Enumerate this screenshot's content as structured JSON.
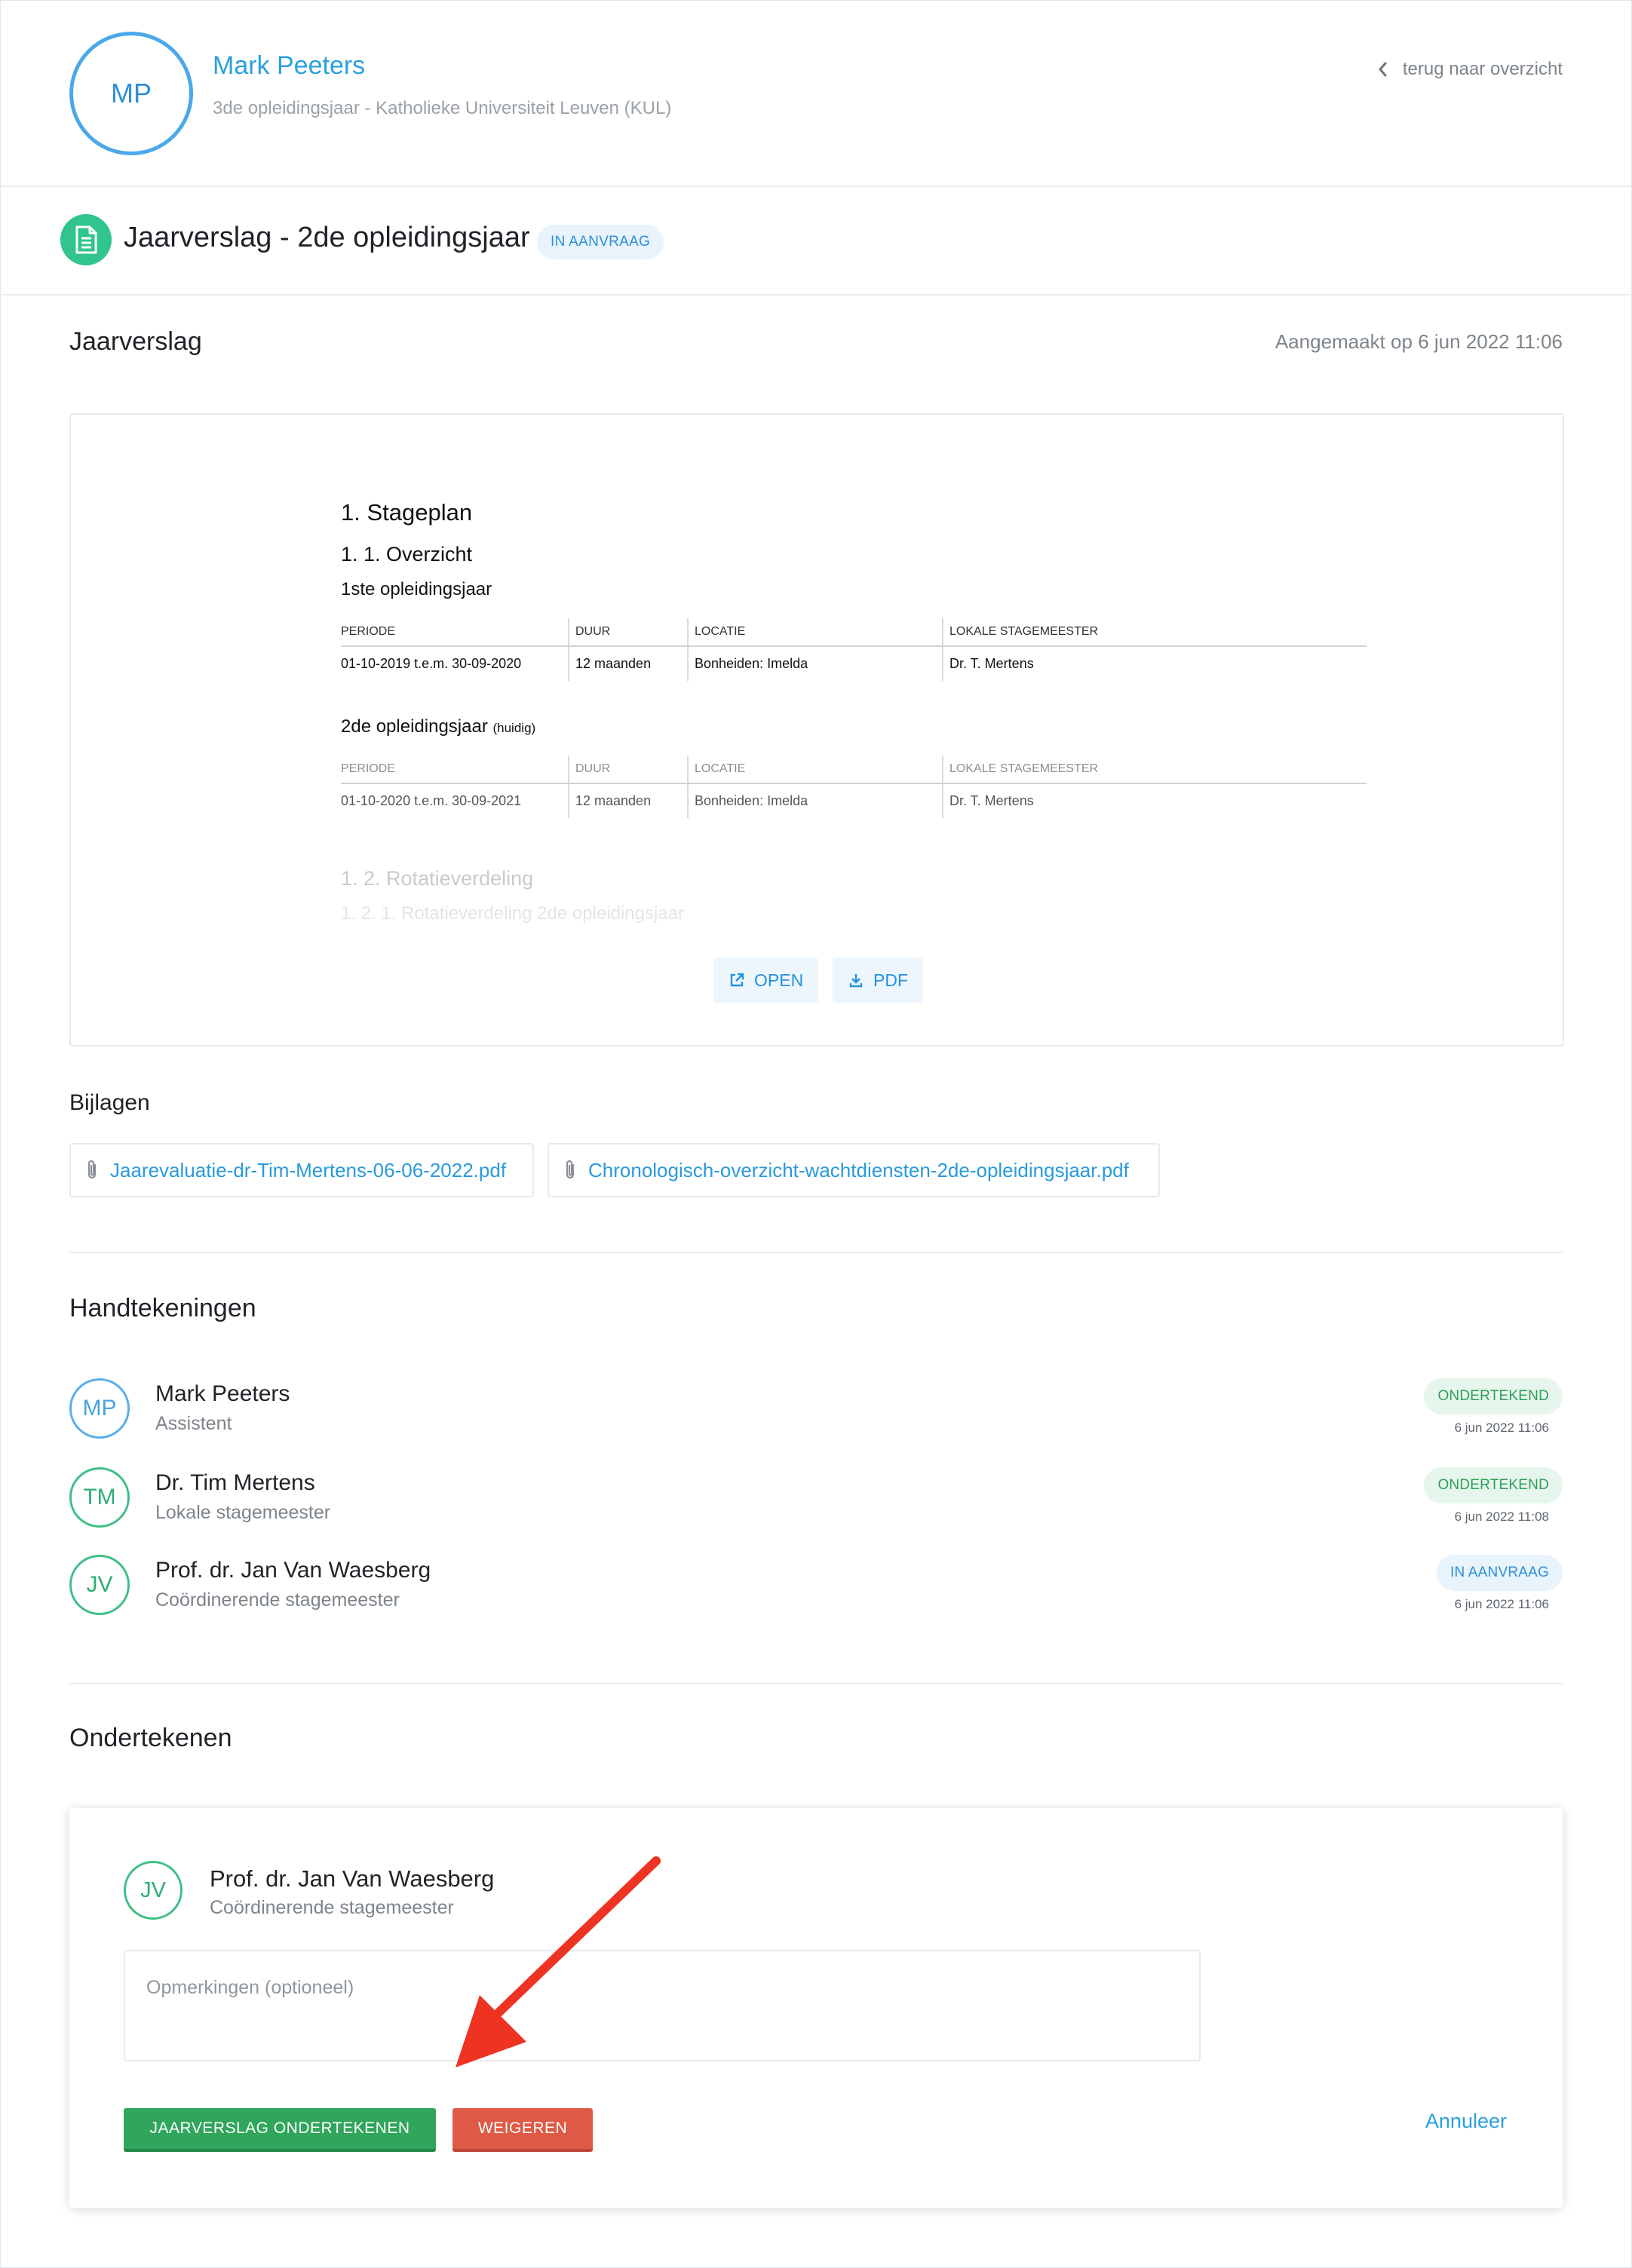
{
  "header": {
    "avatar_initials": "MP",
    "name": "Mark Peeters",
    "subtitle": "3de opleidingsjaar - Katholieke Universiteit Leuven (KUL)",
    "back_label": "terug naar overzicht"
  },
  "title_row": {
    "title": "Jaarverslag - 2de opleidingsjaar",
    "status": "IN AANVRAAG"
  },
  "report": {
    "heading": "Jaarverslag",
    "created": "Aangemaakt op 6 jun 2022 11:06"
  },
  "preview": {
    "h1": "1. Stageplan",
    "h2": "1. 1. Overzicht",
    "year1": {
      "heading": "1ste opleidingsjaar",
      "columns": [
        "PERIODE",
        "DUUR",
        "LOCATIE",
        "LOKALE STAGEMEESTER"
      ],
      "row": [
        "01-10-2019 t.e.m. 30-09-2020",
        "12 maanden",
        "Bonheiden: Imelda",
        "Dr. T. Mertens"
      ]
    },
    "year2": {
      "heading": "2de opleidingsjaar",
      "heading_small": "(huidig)",
      "columns": [
        "PERIODE",
        "DUUR",
        "LOCATIE",
        "LOKALE STAGEMEESTER"
      ],
      "row": [
        "01-10-2020 t.e.m. 30-09-2021",
        "12 maanden",
        "Bonheiden: Imelda",
        "Dr. T. Mertens"
      ]
    },
    "h2_rotation": "1. 2. Rotatieverdeling",
    "h3_rotation": "1. 2. 1. Rotatieverdeling 2de opleidingsjaar",
    "open_label": "OPEN",
    "pdf_label": "PDF"
  },
  "attachments": {
    "heading": "Bijlagen",
    "files": [
      "Jaarevaluatie-dr-Tim-Mertens-06-06-2022.pdf",
      "Chronologisch-overzicht-wachtdiensten-2de-opleidingsjaar.pdf"
    ]
  },
  "signatures": {
    "heading": "Handtekeningen",
    "items": [
      {
        "initials": "MP",
        "name": "Mark Peeters",
        "role": "Assistent",
        "status": "ONDERTEKEND",
        "date": "6 jun 2022 11:06"
      },
      {
        "initials": "TM",
        "name": "Dr. Tim Mertens",
        "role": "Lokale stagemeester",
        "status": "ONDERTEKEND",
        "date": "6 jun 2022 11:08"
      },
      {
        "initials": "JV",
        "name": "Prof. dr. Jan Van Waesberg",
        "role": "Coördinerende stagemeester",
        "status": "IN AANVRAAG",
        "date": "6 jun 2022 11:06"
      }
    ]
  },
  "sign": {
    "heading": "Ondertekenen",
    "initials": "JV",
    "name": "Prof. dr. Jan Van Waesberg",
    "role": "Coördinerende stagemeester",
    "remarks_placeholder": "Opmerkingen (optioneel)",
    "sign_button": "JAARVERSLAG ONDERTEKENEN",
    "refuse_button": "WEIGEREN",
    "cancel": "Annuleer"
  },
  "colors": {
    "accent_blue": "#2aa0dd",
    "success_green": "#2fa65b",
    "danger_red": "#de5a46",
    "annotation_arrow": "#ee3322"
  },
  "icons": [
    "chevron-left-icon",
    "document-icon",
    "external-link-icon",
    "download-icon",
    "paperclip-icon",
    "arrow-annotation"
  ]
}
